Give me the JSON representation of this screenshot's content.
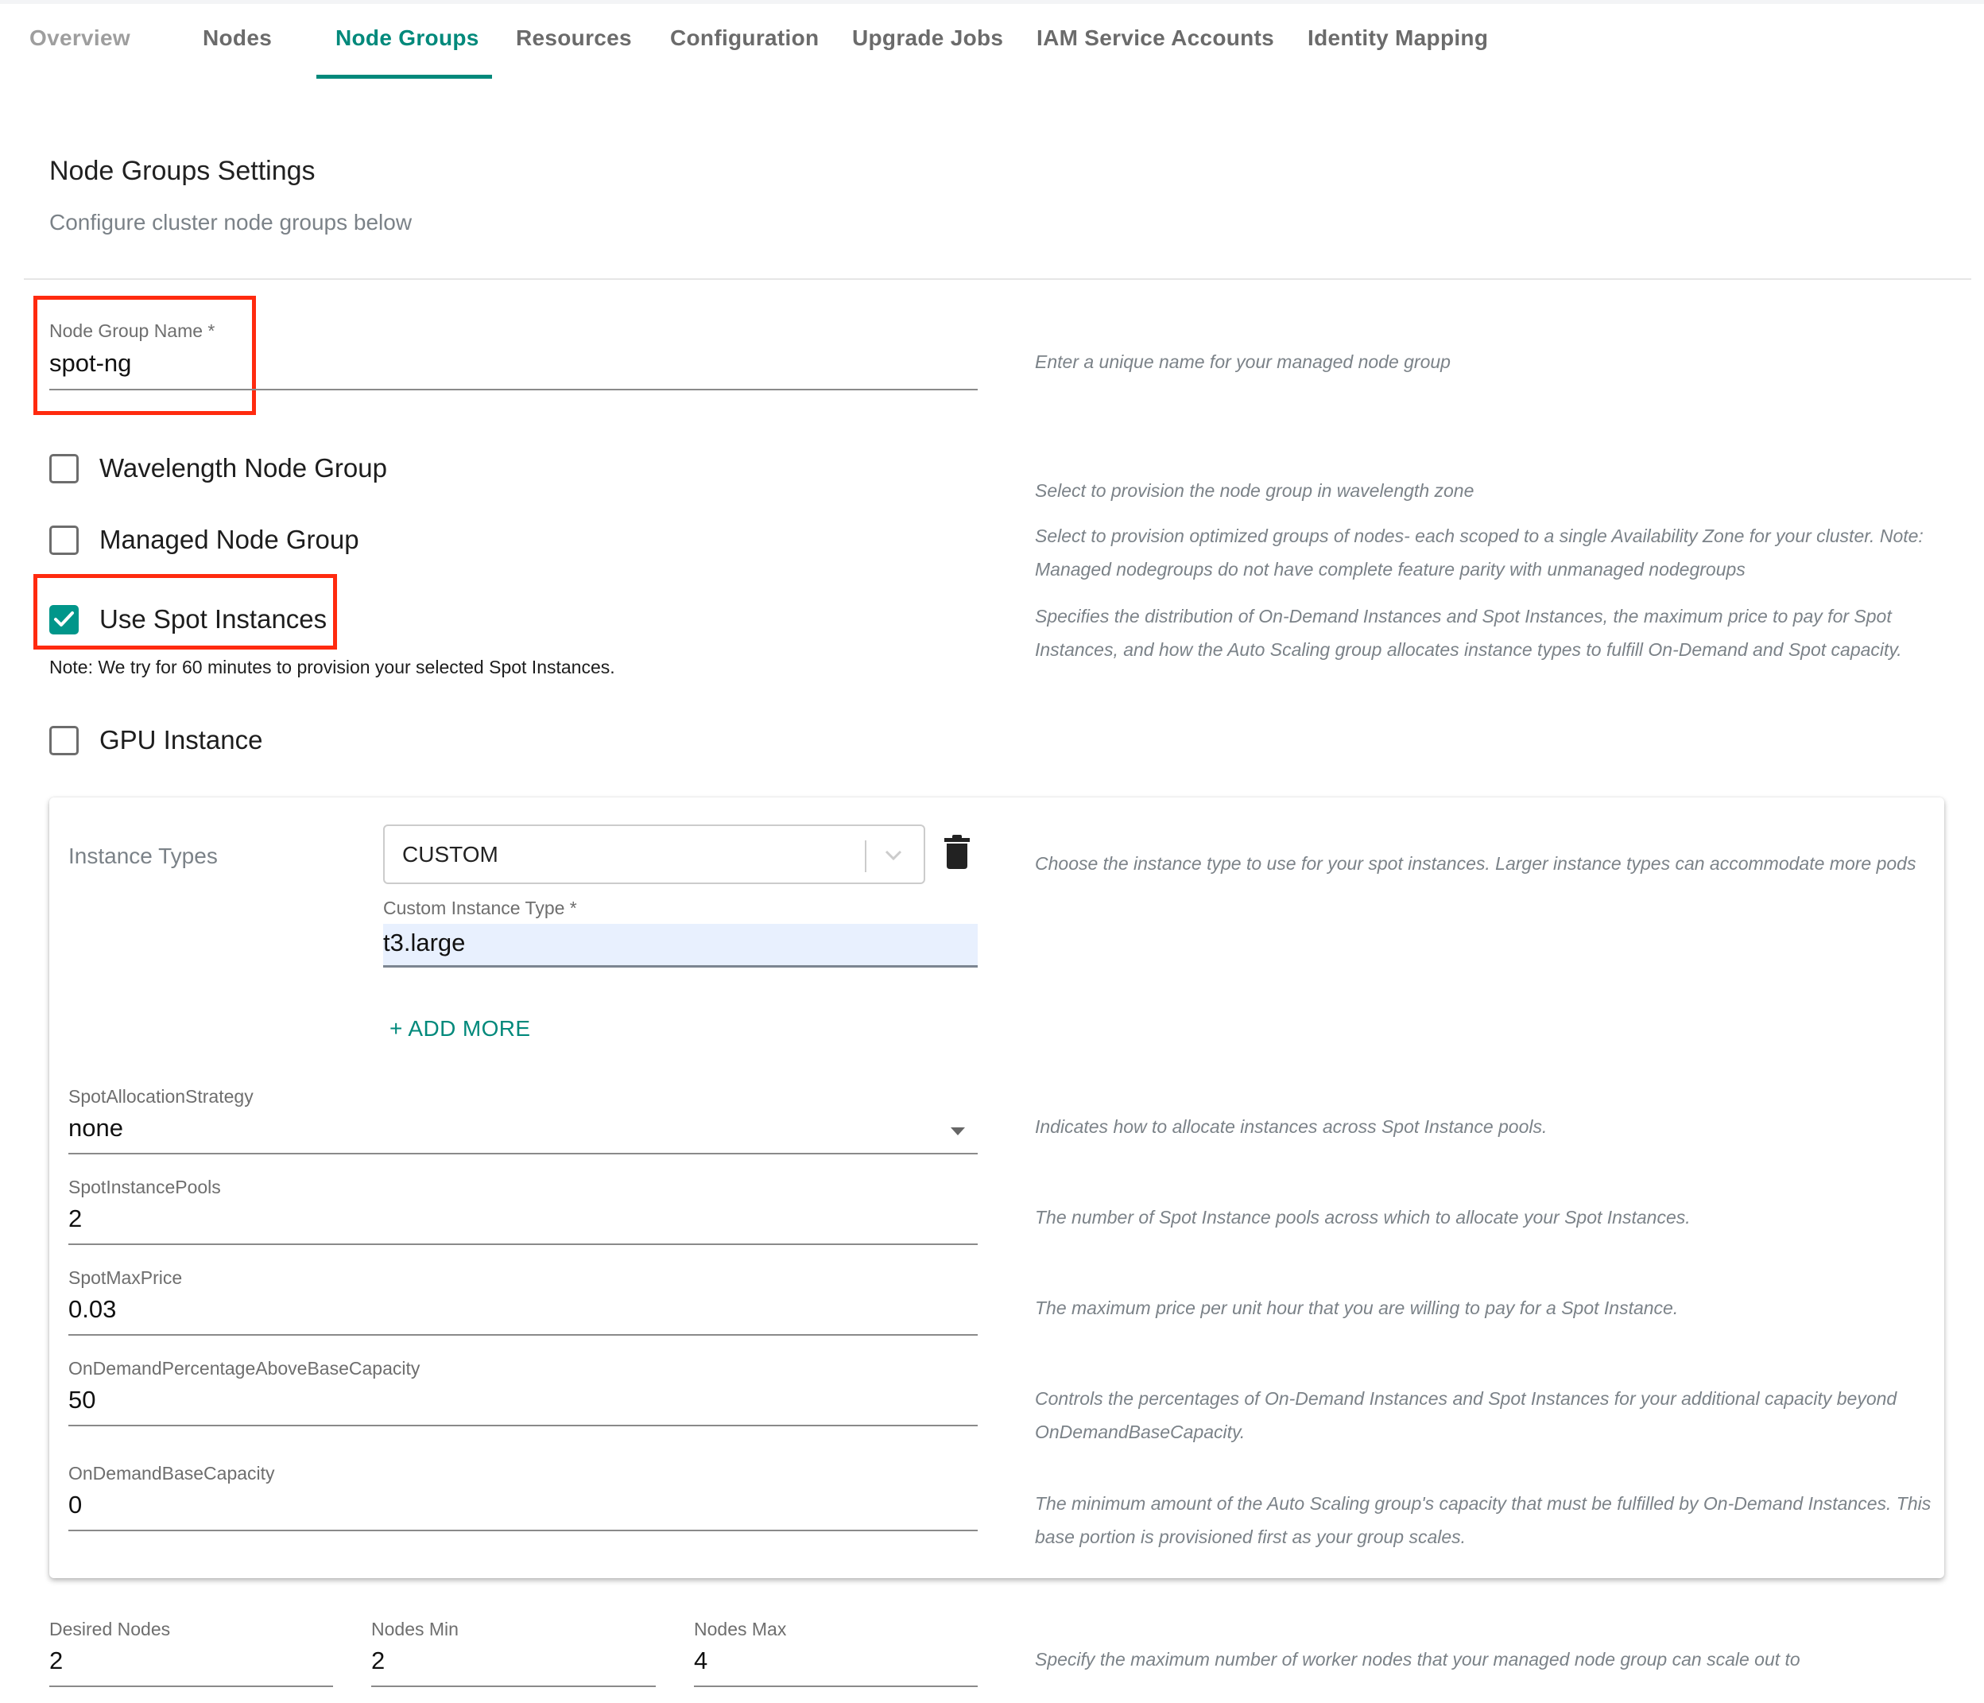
{
  "tabs": [
    {
      "label": "Overview",
      "state": "dim"
    },
    {
      "label": "Nodes",
      "state": "normal"
    },
    {
      "label": "Node Groups",
      "state": "active"
    },
    {
      "label": "Resources",
      "state": "normal"
    },
    {
      "label": "Configuration",
      "state": "normal"
    },
    {
      "label": "Upgrade Jobs",
      "state": "normal"
    },
    {
      "label": "IAM Service Accounts",
      "state": "normal"
    },
    {
      "label": "Identity Mapping",
      "state": "normal"
    }
  ],
  "header": {
    "title": "Node Groups Settings",
    "subtitle": "Configure cluster node groups below"
  },
  "node_group_name": {
    "label": "Node Group Name *",
    "value": "spot-ng",
    "help": "Enter a unique name for your managed node group"
  },
  "checkboxes": {
    "wavelength": {
      "label": "Wavelength Node Group",
      "checked": false,
      "help": "Select to provision the node group in wavelength zone"
    },
    "managed": {
      "label": "Managed Node Group",
      "checked": false,
      "help": "Select to provision optimized groups of nodes- each scoped to a single Availability Zone for your cluster. Note: Managed nodegroups do not have complete feature parity with unmanaged nodegroups"
    },
    "spot": {
      "label": "Use Spot Instances",
      "checked": true,
      "help": "Specifies the distribution of On-Demand Instances and Spot Instances, the maximum price to pay for Spot Instances, and how the Auto Scaling group allocates instance types to fulfill On-Demand and Spot capacity."
    },
    "gpu": {
      "label": "GPU Instance",
      "checked": false
    }
  },
  "spot_note": "Note: We try for 60 minutes to provision your selected Spot Instances.",
  "spot_card": {
    "instance_types": {
      "label": "Instance Types",
      "select_value": "CUSTOM",
      "custom_label": "Custom Instance Type *",
      "custom_value": "t3.large",
      "add_more": "+ ADD MORE",
      "help": "Choose the instance type to use for your spot instances. Larger instance types can accommodate more pods"
    },
    "allocation_strategy": {
      "label": "SpotAllocationStrategy",
      "value": "none",
      "help": "Indicates how to allocate instances across Spot Instance pools."
    },
    "instance_pools": {
      "label": "SpotInstancePools",
      "value": "2",
      "help": "The number of Spot Instance pools across which to allocate your Spot Instances."
    },
    "max_price": {
      "label": "SpotMaxPrice",
      "value": "0.03",
      "help": "The maximum price per unit hour that you are willing to pay for a Spot Instance."
    },
    "on_demand_pct": {
      "label": "OnDemandPercentageAboveBaseCapacity",
      "value": "50",
      "help": "Controls the percentages of On-Demand Instances and Spot Instances for your additional capacity beyond OnDemandBaseCapacity."
    },
    "on_demand_base": {
      "label": "OnDemandBaseCapacity",
      "value": "0",
      "help": "The minimum amount of the Auto Scaling group's capacity that must be fulfilled by On-Demand Instances. This base portion is provisioned first as your group scales."
    }
  },
  "scaling": {
    "desired": {
      "label": "Desired Nodes",
      "value": "2"
    },
    "min": {
      "label": "Nodes Min",
      "value": "2"
    },
    "max": {
      "label": "Nodes Max",
      "value": "4"
    },
    "help": "Specify the maximum number of worker nodes that your managed node group can scale out to"
  },
  "colors": {
    "accent": "#00897b",
    "checkbox_checked": "#00968a",
    "highlight_box": "#ff2a0f",
    "autofill_bg": "#e8f0fe"
  }
}
